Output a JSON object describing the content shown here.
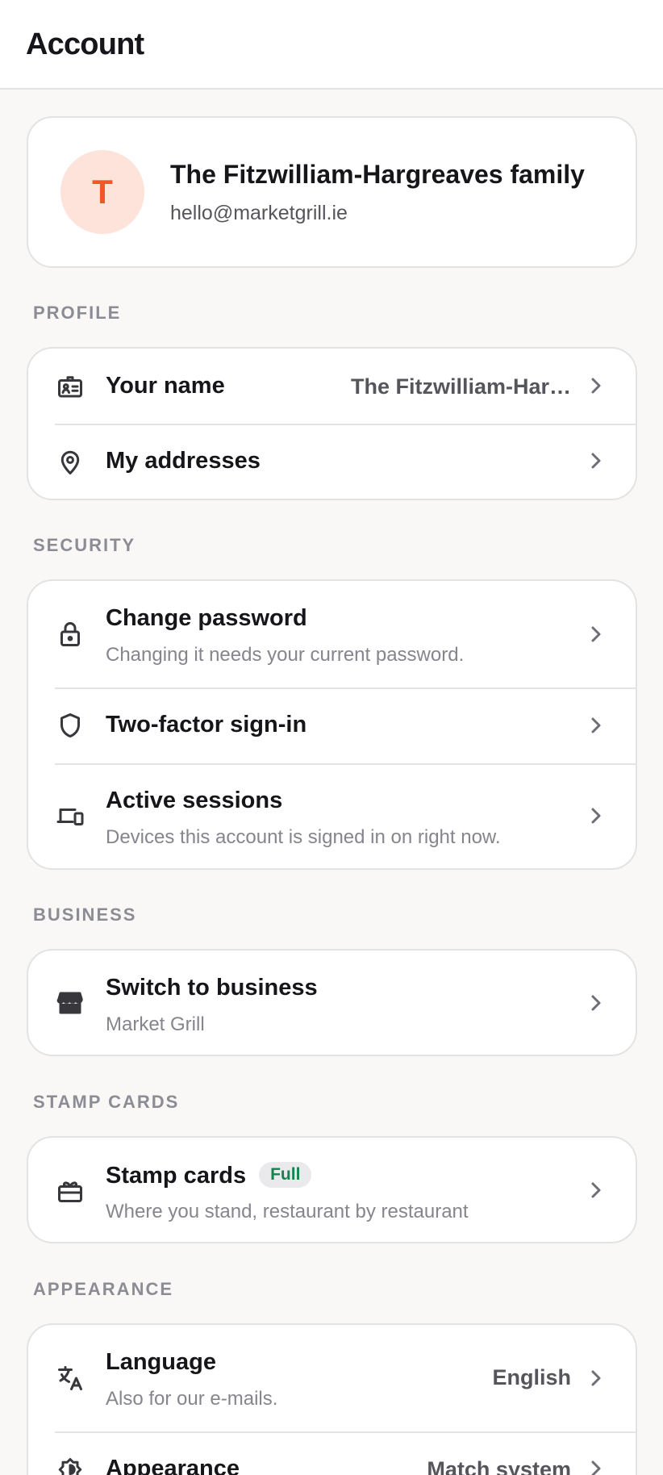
{
  "header": {
    "title": "Account"
  },
  "profile": {
    "avatar_letter": "T",
    "name": "The Fitzwilliam-Hargreaves family",
    "email": "hello@marketgrill.ie"
  },
  "sections": {
    "profile": {
      "label": "PROFILE",
      "your_name": {
        "title": "Your name",
        "value": "The Fitzwilliam-Har…"
      },
      "addresses": {
        "title": "My addresses"
      }
    },
    "security": {
      "label": "SECURITY",
      "change_password": {
        "title": "Change password",
        "subtitle": "Changing it needs your current password."
      },
      "two_factor": {
        "title": "Two-factor sign-in"
      },
      "sessions": {
        "title": "Active sessions",
        "subtitle": "Devices this account is signed in on right now."
      }
    },
    "business": {
      "label": "BUSINESS",
      "switch": {
        "title": "Switch to business",
        "subtitle": "Market Grill"
      }
    },
    "stamp_cards": {
      "label": "STAMP CARDS",
      "stamp": {
        "title": "Stamp cards",
        "badge": "Full",
        "subtitle": "Where you stand, restaurant by restaurant"
      }
    },
    "appearance": {
      "label": "APPEARANCE",
      "language": {
        "title": "Language",
        "subtitle": "Also for our e-mails.",
        "value": "English"
      },
      "theme": {
        "title": "Appearance",
        "value": "Match system"
      }
    }
  },
  "colors": {
    "accent": "#f2562a",
    "avatar_bg": "#fde3da",
    "badge_text": "#16834f",
    "background": "#f9f8f6"
  },
  "icons": {
    "your_name": "id-card-icon",
    "addresses": "map-pin-icon",
    "change_password": "lock-icon",
    "two_factor": "shield-icon",
    "sessions": "devices-icon",
    "switch": "store-icon",
    "stamp": "gift-card-icon",
    "language": "translate-icon",
    "theme": "contrast-icon",
    "chevron": "chevron-right-icon"
  }
}
